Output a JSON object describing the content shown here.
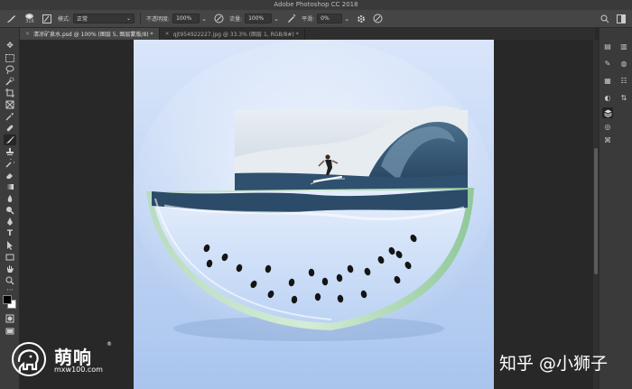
{
  "app": {
    "title": "Adobe Photoshop CC 2018"
  },
  "options_bar": {
    "brush_size": "316",
    "mode_label": "模式:",
    "mode_value": "正常",
    "opacity_label": "不透明度:",
    "opacity_value": "100%",
    "flow_label": "流量:",
    "flow_value": "100%",
    "smoothing_label": "平滑:",
    "smoothing_value": "0%"
  },
  "tabs": [
    {
      "label": "清凉矿泉水.psd @ 100% (图层 5, 图层蒙版/8) *",
      "active": true
    },
    {
      "label": "qjt954922227.jpg @ 33.3% (图层 1, RGB/8#) *",
      "active": false
    }
  ],
  "watermarks": {
    "left_name": "萌响",
    "left_url": "mxw100.com",
    "registered": "®",
    "right_text": "知乎 @小狮子"
  },
  "colors": {
    "canvas_bg_top": "#d9e5fa",
    "canvas_bg_bottom": "#a9c5ee",
    "rind": "#9fcf9e",
    "ui_panel": "#3c3c3c"
  },
  "icons": {
    "app_home": "ps-home-icon",
    "brush": "brush-icon",
    "settings": "gear-icon"
  }
}
